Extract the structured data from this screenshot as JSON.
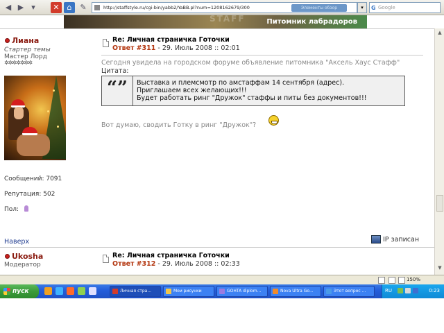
{
  "browser": {
    "url": "http://staffstyle.ru/cgi-bin/yabb2/YaBB.pl?num=1208162679/300",
    "url_overlay": "Элементы   обзор",
    "search_placeholder": "Google",
    "search_logo": "G"
  },
  "banner": {
    "title": "Питомник лабрадоров"
  },
  "posts": [
    {
      "author": "Лиана",
      "author_title": "Стартер темы",
      "rank": "Мастер Лорд",
      "stars": "✲✲✲✲✲✲✲",
      "subject": "Re: Личная страничка Готочки",
      "reply_label": "Ответ",
      "reply_num": "#311",
      "date": "- 29. Июль 2008 :: 02:01",
      "intro": "Сегодня увидела на городском форуме объявление питомника \"Аксель Хаус Стафф\"",
      "quote_label": "Цитата:",
      "quote_marks": "“”",
      "quote_lines": [
        "Выставка и племсмотр по амстаффам 14 сентября (адрес).",
        "Приглашаем всех желающих!!!",
        "Будет работать ринг \"Дружок\" стаффы и питы без документов!!!"
      ],
      "comment": "Вот думаю, сводить Готку в ринг \"Дружок\"?",
      "posts_count": "Сообщений: 7091",
      "reputation": "Репутация: 502",
      "gender_label": "Пол:",
      "top_link": "Наверх",
      "ip_label": "IP записан"
    },
    {
      "author": "Ukosha",
      "author_title": "Модератор",
      "subject": "Re: Личная страничка Готочки",
      "reply_label": "Ответ",
      "reply_num": "#312",
      "date": "- 29. Июль 2008 :: 02:33"
    }
  ],
  "statusbar": {
    "zoom": "150%"
  },
  "taskbar": {
    "start_label": "пуск",
    "tasks": [
      "Личная стра...",
      "Мои рисунки",
      "GOHTA diplom...",
      "Nova Ultra Go...",
      "Этот вопрос ..."
    ],
    "lang": "RU",
    "clock": "0:23"
  },
  "colors": {
    "username": "#8a1b10",
    "reply_num": "#b3360f",
    "link": "#1f3b8f",
    "taskbar": "#245edb",
    "start": "#3a9a3a"
  }
}
